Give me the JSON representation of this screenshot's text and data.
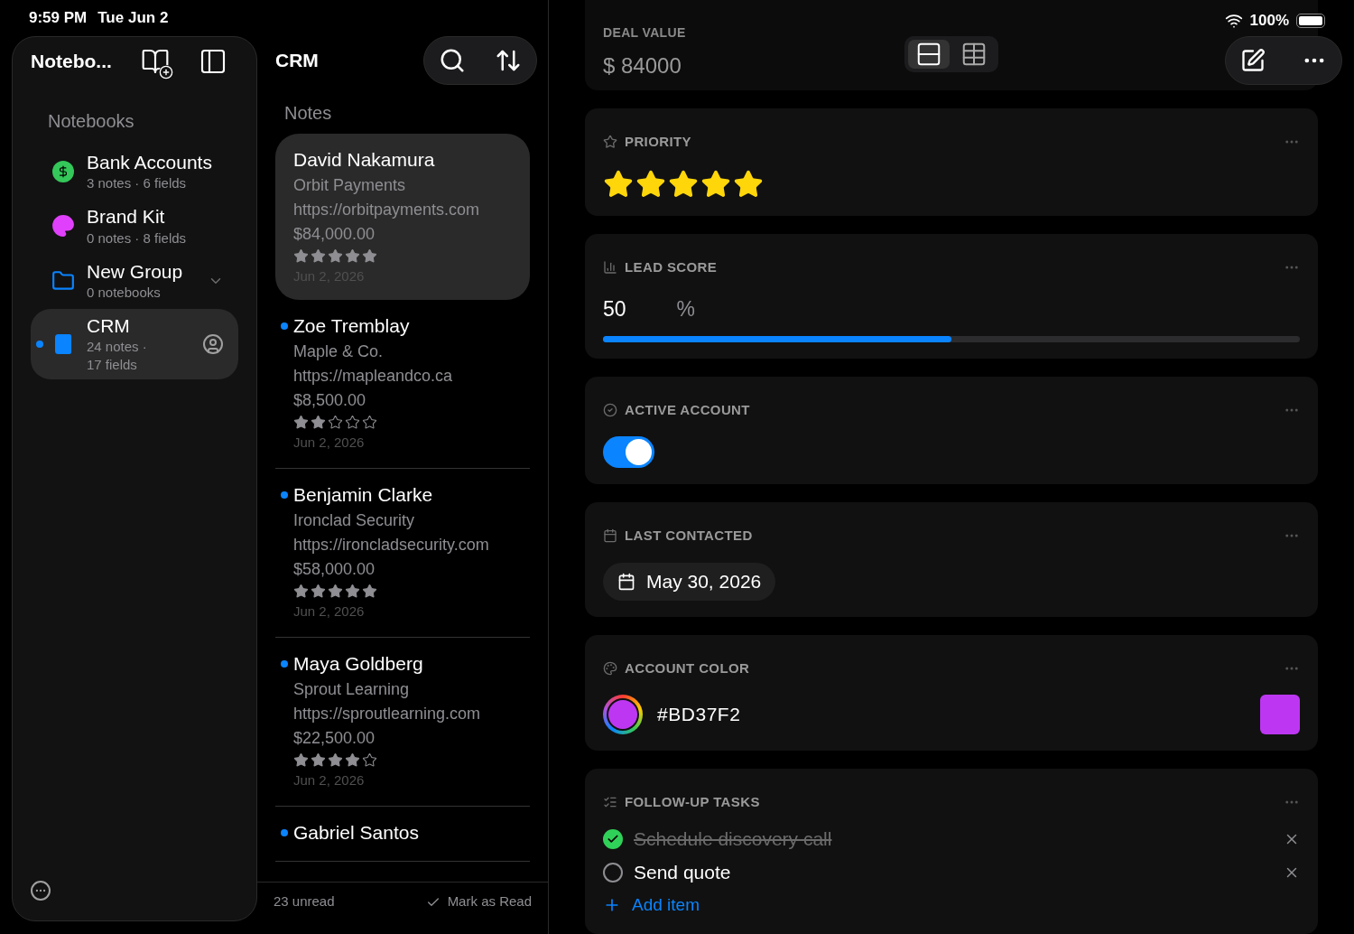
{
  "status_bar": {
    "time": "9:59 PM",
    "date": "Tue Jun 2",
    "battery": "100%"
  },
  "sidebar": {
    "title": "Notebo...",
    "section": "Notebooks",
    "items": [
      {
        "kind": "finance",
        "color": "#34c759",
        "name": "Bank Accounts",
        "meta": "3 notes · 6 fields",
        "selected": false
      },
      {
        "kind": "design",
        "color": "#e040fb",
        "name": "Brand Kit",
        "meta": "0 notes · 8 fields",
        "selected": false
      },
      {
        "kind": "group",
        "color": "#0a84ff",
        "name": "New Group",
        "meta": "0 notebooks",
        "expanded": false,
        "selected": false
      },
      {
        "kind": "shared",
        "color": "#0a84ff",
        "name": "CRM",
        "meta": "24 notes ·\n17 fields",
        "selected": true
      }
    ]
  },
  "notes": {
    "title": "CRM",
    "section": "Notes",
    "items": [
      {
        "name": "David Nakamura",
        "company": "Orbit Payments",
        "url": "https://orbitpayments.com",
        "amount": "$84,000.00",
        "stars": 5,
        "date": "Jun 2, 2026",
        "unread": false,
        "selected": true
      },
      {
        "name": "Zoe Tremblay",
        "company": "Maple & Co.",
        "url": "https://mapleandco.ca",
        "amount": "$8,500.00",
        "stars": 2,
        "date": "Jun 2, 2026",
        "unread": true,
        "selected": false
      },
      {
        "name": "Benjamin Clarke",
        "company": "Ironclad Security",
        "url": "https://ironcladsecurity.com",
        "amount": "$58,000.00",
        "stars": 5,
        "date": "Jun 2, 2026",
        "unread": true,
        "selected": false
      },
      {
        "name": "Maya Goldberg",
        "company": "Sprout Learning",
        "url": "https://sproutlearning.com",
        "amount": "$22,500.00",
        "stars": 4,
        "date": "Jun 2, 2026",
        "unread": true,
        "selected": false
      },
      {
        "name": "Gabriel Santos",
        "unread": true,
        "selected": false
      }
    ],
    "footer": {
      "count": "23 unread",
      "action": "Mark as Read"
    }
  },
  "detail": {
    "view_modes": [
      {
        "kind": "rows",
        "selected": true
      },
      {
        "kind": "grid",
        "selected": false
      }
    ],
    "deal_value": {
      "label": "DEAL VALUE",
      "value": "$ 84000"
    },
    "fields": [
      {
        "kind": "rating",
        "label": "PRIORITY",
        "stars": 5
      },
      {
        "kind": "progress",
        "label": "LEAD SCORE",
        "value": "50",
        "unit": "%",
        "level": 0.5
      },
      {
        "kind": "toggle",
        "label": "ACTIVE ACCOUNT",
        "on": true
      },
      {
        "kind": "date",
        "label": "LAST CONTACTED",
        "value": "May 30, 2026"
      },
      {
        "kind": "color",
        "label": "ACCOUNT COLOR",
        "value": "#BD37F2"
      },
      {
        "kind": "checklist",
        "label": "FOLLOW-UP TASKS",
        "tasks": [
          {
            "text": "Schedule discovery call",
            "checked": true
          },
          {
            "text": "Send quote",
            "checked": false
          }
        ],
        "add_label": "Add item"
      }
    ]
  }
}
